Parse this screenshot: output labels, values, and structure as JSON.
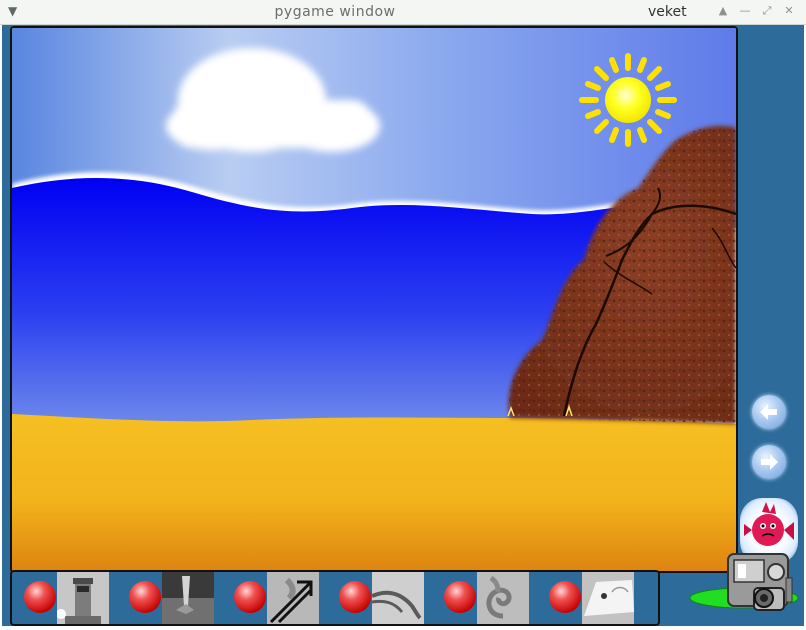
{
  "window": {
    "title": "pygame window",
    "app_name": "veket"
  },
  "scene": {
    "description_icons": [
      "cloud-icon",
      "sun-icon",
      "rock-icon"
    ]
  },
  "navigation": {
    "prev_icon": "arrow-left-icon",
    "next_icon": "arrow-right-icon"
  },
  "stamps": [
    {
      "icon": "lighthouse-icon"
    },
    {
      "icon": "wrench-icon"
    },
    {
      "icon": "arrow-icon"
    },
    {
      "icon": "claw-icon"
    },
    {
      "icon": "shell-icon"
    },
    {
      "icon": "fish-icon"
    }
  ],
  "colors": {
    "frame": "#2c6b9a",
    "sea": "#0000f0",
    "sand": "#f5bb1a",
    "sun": "#ffff00",
    "rock": "#8b3b22"
  }
}
